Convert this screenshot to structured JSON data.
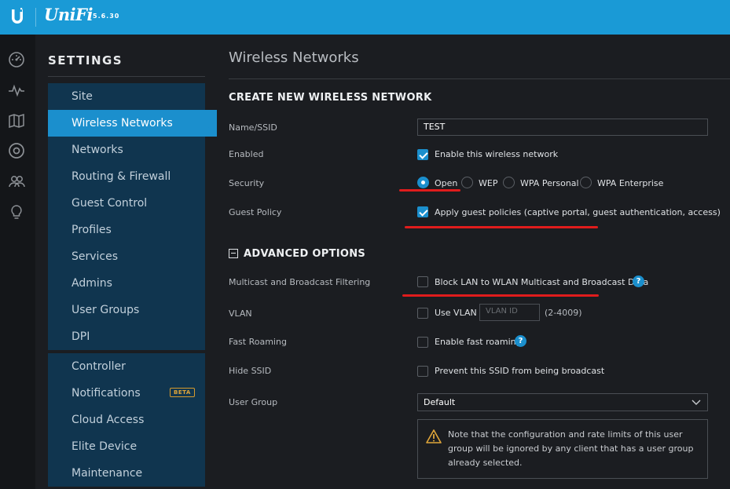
{
  "app": {
    "brand": "UniFi",
    "version": "5.6.30"
  },
  "rail": {
    "icons": [
      "dashboard-icon",
      "statistics-icon",
      "map-icon",
      "devices-icon",
      "clients-icon",
      "insights-icon"
    ]
  },
  "nav": {
    "title": "SETTINGS",
    "items": [
      {
        "label": "Site"
      },
      {
        "label": "Wireless Networks",
        "active": true
      },
      {
        "label": "Networks"
      },
      {
        "label": "Routing & Firewall"
      },
      {
        "label": "Guest Control"
      },
      {
        "label": "Profiles"
      },
      {
        "label": "Services"
      },
      {
        "label": "Admins"
      },
      {
        "label": "User Groups"
      },
      {
        "label": "DPI"
      }
    ],
    "items2": [
      {
        "label": "Controller"
      },
      {
        "label": "Notifications",
        "badge": "BETA"
      },
      {
        "label": "Cloud Access"
      },
      {
        "label": "Elite Device"
      },
      {
        "label": "Maintenance"
      }
    ]
  },
  "main": {
    "page_title": "Wireless Networks",
    "section_create": "CREATE NEW WIRELESS NETWORK",
    "name_label": "Name/SSID",
    "name_value": "TEST",
    "enabled_label": "Enabled",
    "enabled_text": "Enable this wireless network",
    "security_label": "Security",
    "security_options": [
      "Open",
      "WEP",
      "WPA Personal",
      "WPA Enterprise"
    ],
    "security_selected": "Open",
    "guest_label": "Guest Policy",
    "guest_text": "Apply guest policies (captive portal, guest authentication, access)",
    "section_advanced": "ADVANCED OPTIONS",
    "multicast_label": "Multicast and Broadcast Filtering",
    "multicast_text": "Block LAN to WLAN Multicast and Broadcast Data",
    "vlan_label": "VLAN",
    "vlan_text": "Use VLAN",
    "vlan_placeholder": "VLAN ID",
    "vlan_range": "(2-4009)",
    "roaming_label": "Fast Roaming",
    "roaming_text": "Enable fast roaming",
    "hide_label": "Hide SSID",
    "hide_text": "Prevent this SSID from being broadcast",
    "usergroup_label": "User Group",
    "usergroup_value": "Default",
    "note_text": "Note that the configuration and rate limits of this user group will be ignored by any client that has a user group already selected."
  },
  "colors": {
    "accent": "#1b8fcd",
    "topbar": "#1a9ad6",
    "annotation": "#e01c1c",
    "warning": "#e0a63a"
  }
}
